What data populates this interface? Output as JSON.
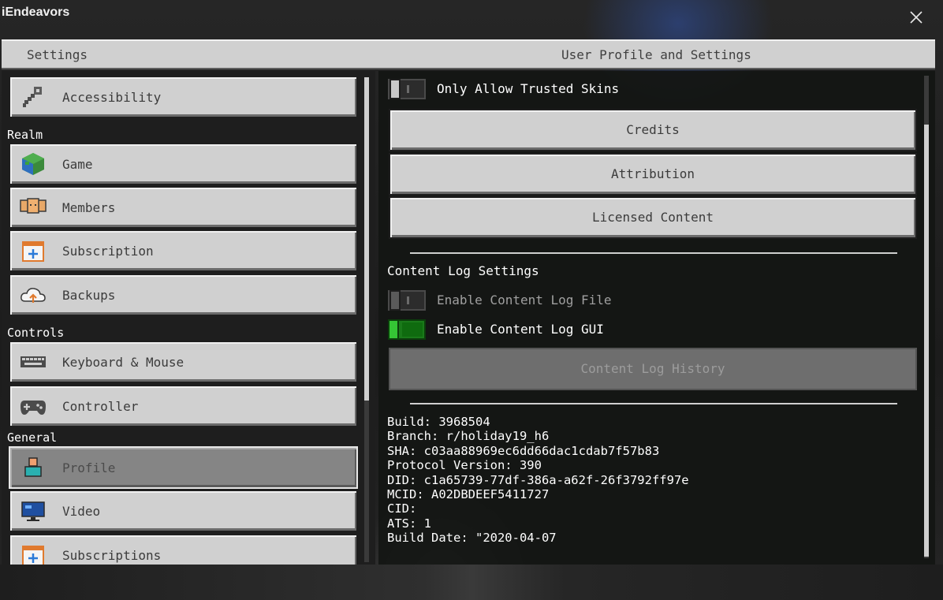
{
  "window": {
    "title": "iEndeavors"
  },
  "header": {
    "left_title": "Settings",
    "right_title": "User Profile and Settings"
  },
  "sidebar": {
    "items_top": [
      {
        "label": "Accessibility",
        "icon": "key-icon"
      }
    ],
    "sections": [
      {
        "label": "Realm",
        "items": [
          {
            "label": "Game",
            "icon": "globe-block-icon"
          },
          {
            "label": "Members",
            "icon": "members-icon"
          },
          {
            "label": "Subscription",
            "icon": "calendar-plus-icon"
          },
          {
            "label": "Backups",
            "icon": "cloud-upload-icon"
          }
        ]
      },
      {
        "label": "Controls",
        "items": [
          {
            "label": "Keyboard & Mouse",
            "icon": "keyboard-icon"
          },
          {
            "label": "Controller",
            "icon": "gamepad-icon"
          }
        ]
      },
      {
        "label": "General",
        "items": [
          {
            "label": "Profile",
            "icon": "profile-icon",
            "active": true
          },
          {
            "label": "Video",
            "icon": "monitor-icon"
          },
          {
            "label": "Subscriptions",
            "icon": "calendar-plus-icon"
          }
        ]
      }
    ]
  },
  "main": {
    "trusted_skins": {
      "label": "Only Allow Trusted Skins",
      "enabled": false
    },
    "buttons": {
      "credits": "Credits",
      "attribution": "Attribution",
      "licensed": "Licensed Content"
    },
    "content_log": {
      "title": "Content Log Settings",
      "file": {
        "label": "Enable Content Log File",
        "enabled": false
      },
      "gui": {
        "label": "Enable Content Log GUI",
        "enabled": true
      },
      "history_button": "Content Log History"
    },
    "info": {
      "build": "Build: 3968504",
      "branch": "Branch: r/holiday19_h6",
      "sha": "SHA: c03aa88969ec6dd66dac1cdab7f57b83",
      "protocol": "Protocol Version: 390",
      "did": "DID: c1a65739-77df-386a-a62f-26f3792ff97e",
      "mcid": "MCID: A02DBDEEF5411727",
      "cid": "CID:",
      "ats": "ATS: 1",
      "build_date": "Build Date: \"2020-04-07"
    }
  },
  "colors": {
    "toggle_on": "#1a7a1a",
    "button_bg": "#d0d0d0",
    "active_bg": "#858585"
  }
}
